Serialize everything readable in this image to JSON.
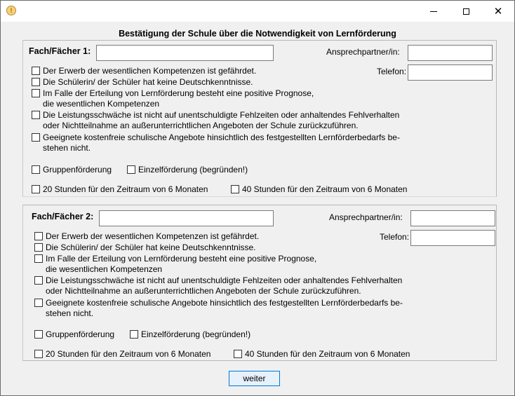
{
  "window": {
    "title": "",
    "icon": "app-icon",
    "controls": {
      "minimize": "minimize-icon",
      "maximize": "maximize-icon",
      "close_glyph": "✕"
    }
  },
  "heading": "Bestätigung der Schule über die Notwendigkeit von Lernförderung",
  "sections": [
    {
      "subject_label": "Fach/Fächer 1:",
      "subject_value": "",
      "contact_label": "Ansprechpartner/in:",
      "contact_value": "",
      "phone_label": "Telefon:",
      "phone_value": "",
      "criteria": [
        {
          "line1": "Der Erwerb der wesentlichen Kompetenzen ist gefährdet.",
          "line2": "",
          "checked": false
        },
        {
          "line1": "Die Schülerin/ der Schüler hat keine Deutschkenntnisse.",
          "line2": "",
          "checked": false
        },
        {
          "line1": "Im Falle der Erteilung von Lernförderung besteht eine positive Prognose,",
          "line2": "die wesentlichen Kompetenzen",
          "checked": false
        },
        {
          "line1": "Die Leistungsschwäche ist nicht auf unentschuldigte Fehlzeiten oder anhaltendes Fehlverhalten",
          "line2": "oder Nichtteilnahme an außerunterrichtlichen Angeboten der Schule zurückzuführen.",
          "checked": false
        },
        {
          "line1": "Geeignete kostenfreie schulische Angebote hinsichtlich des festgestellten Lernförderbedarfs be-",
          "line2": "stehen nicht.",
          "checked": false
        }
      ],
      "group_label": "Gruppenförderung",
      "individual_label": "Einzelförderung (begründen!)",
      "hours20_label": "20 Stunden für den Zeitraum von 6 Monaten",
      "hours40_label": "40 Stunden für den Zeitraum von 6 Monaten"
    },
    {
      "subject_label": "Fach/Fächer 2:",
      "subject_value": "",
      "contact_label": "Ansprechpartner/in:",
      "contact_value": "",
      "phone_label": "Telefon:",
      "phone_value": "",
      "criteria": [
        {
          "line1": "Der Erwerb der wesentlichen Kompetenzen ist gefährdet.",
          "line2": "",
          "checked": false
        },
        {
          "line1": "Die Schülerin/ der Schüler hat keine Deutschkenntnisse.",
          "line2": "",
          "checked": false
        },
        {
          "line1": "Im Falle der Erteilung von Lernförderung besteht eine positive Prognose,",
          "line2": "die wesentlichen Kompetenzen",
          "checked": false
        },
        {
          "line1": "Die Leistungsschwäche ist nicht auf unentschuldigte Fehlzeiten oder anhaltendes Fehlverhalten",
          "line2": "oder Nichtteilnahme an außerunterrichtlichen Angeboten der Schule zurückzuführen.",
          "checked": false
        },
        {
          "line1": "Geeignete kostenfreie schulische Angebote hinsichtlich des festgestellten Lernförderbedarfs be-",
          "line2": "stehen nicht.",
          "checked": false
        }
      ],
      "group_label": "Gruppenförderung",
      "individual_label": "Einzelförderung (begründen!)",
      "hours20_label": "20 Stunden für den Zeitraum von 6 Monaten",
      "hours40_label": "40 Stunden für den Zeitraum von 6 Monaten"
    }
  ],
  "continue_button": "weiter",
  "colors": {
    "window_bg": "#f0f0f0",
    "button_border": "#0078d7",
    "button_bg": "#e5f1fb"
  }
}
